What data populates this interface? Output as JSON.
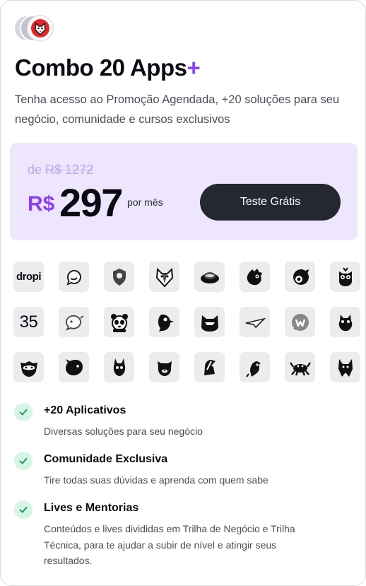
{
  "card": {
    "title": "Combo 20 Apps",
    "title_plus": "+",
    "description": "Tenha acesso ao Promoção Agendada, +20 soluções para seu negócio, comunidade e cursos exclusivos"
  },
  "pricing": {
    "old_prefix": "de",
    "old_price": "R$ 1272",
    "currency": "R$",
    "amount": "297",
    "period": "por mês",
    "cta_label": "Teste Grátis",
    "accent_color": "#8a3ffc",
    "box_color": "#ede6fd"
  },
  "apps": [
    {
      "icon": "dropi-logo-icon",
      "label": "dropi"
    },
    {
      "icon": "chat-bubble-icon"
    },
    {
      "icon": "shield-pin-icon"
    },
    {
      "icon": "fox-mascot-icon"
    },
    {
      "icon": "hat-disc-icon"
    },
    {
      "icon": "dragon-mascot-icon"
    },
    {
      "icon": "chameleon-mascot-icon"
    },
    {
      "icon": "owl-mascot-icon"
    },
    {
      "icon": "number-35-icon",
      "label": "35"
    },
    {
      "icon": "speech-bubble-icon"
    },
    {
      "icon": "panda-mascot-icon"
    },
    {
      "icon": "bird-mascot-icon"
    },
    {
      "icon": "cat-mascot-icon"
    },
    {
      "icon": "paper-plane-icon"
    },
    {
      "icon": "w-bubble-icon"
    },
    {
      "icon": "goat-mascot-icon"
    },
    {
      "icon": "raccoon-mascot-icon"
    },
    {
      "icon": "rhino-mascot-icon"
    },
    {
      "icon": "donkey-mascot-icon"
    },
    {
      "icon": "dog-mascot-icon"
    },
    {
      "icon": "horse-mascot-icon"
    },
    {
      "icon": "parrot-mascot-icon"
    },
    {
      "icon": "crab-mascot-icon"
    },
    {
      "icon": "wolf-mascot-icon"
    }
  ],
  "features": [
    {
      "title": "+20 Aplicativos",
      "description": "Diversas soluções para seu negócio"
    },
    {
      "title": "Comunidade Exclusiva",
      "description": "Tire todas suas dúvidas e aprenda com quem sabe"
    },
    {
      "title": "Lives e Mentorias",
      "description": "Conteúdos e lives divididas em Trilha de Negócio e Trilha Técnica, para te ajudar a subir de nível e atingir seus resultados."
    }
  ]
}
